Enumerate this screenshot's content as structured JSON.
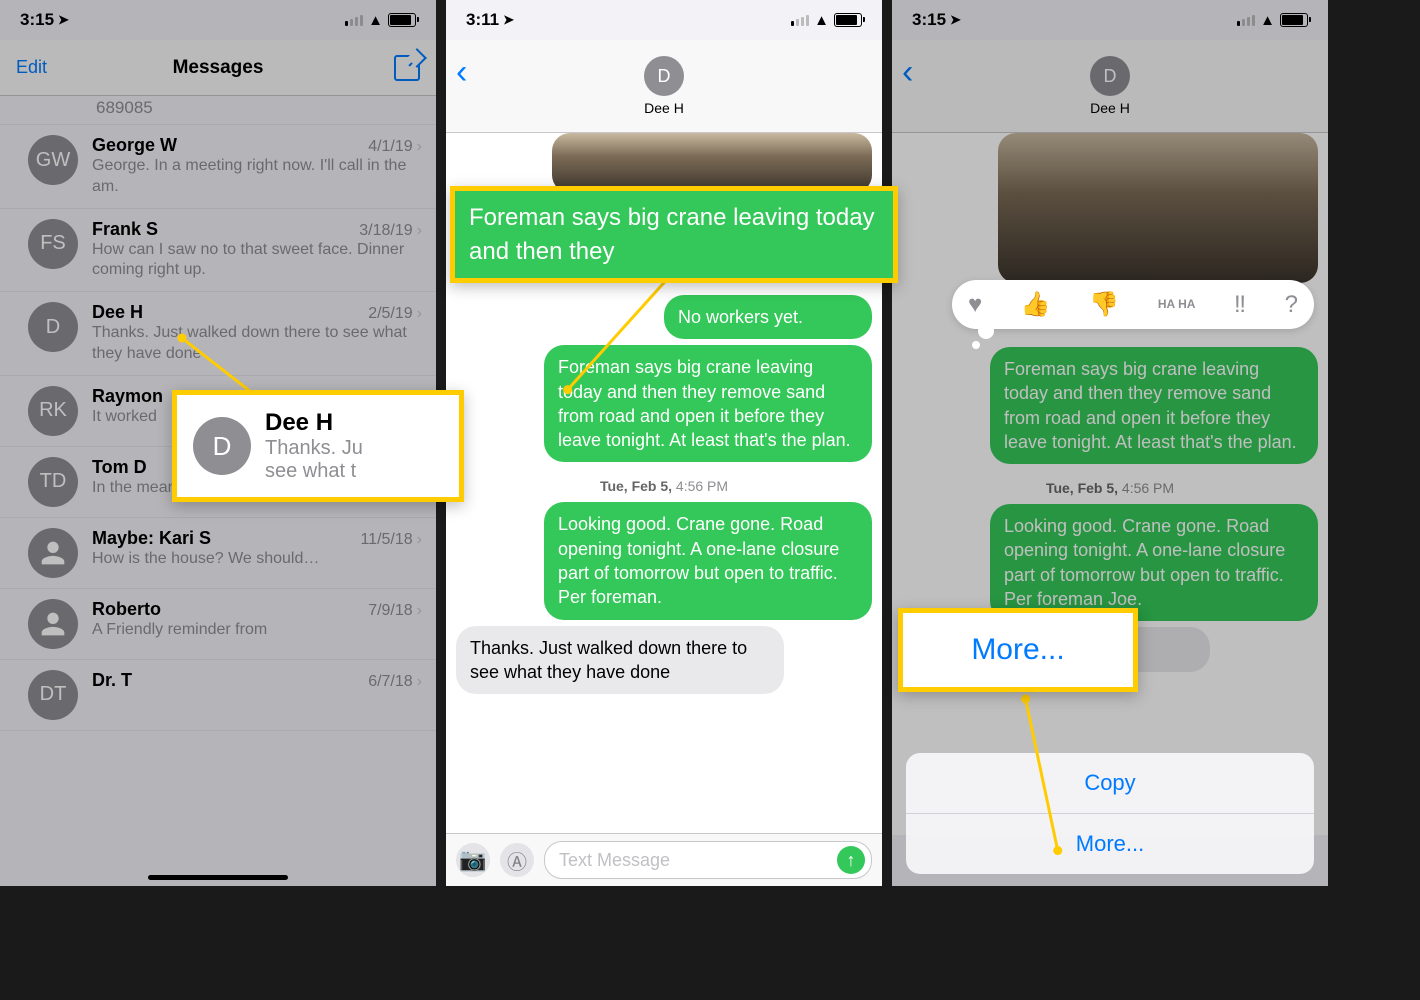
{
  "screens": {
    "s1": {
      "time": "3:15",
      "title": "Messages",
      "edit": "Edit",
      "prevrow": "689085"
    },
    "s2": {
      "time": "3:11",
      "contact": "Dee H",
      "placeholder": "Text Message"
    },
    "s3": {
      "time": "3:15",
      "contact": "Dee H"
    }
  },
  "conversations": [
    {
      "initials": "GW",
      "name": "George W",
      "date": "4/1/19",
      "preview": "George. In a meeting right now. I'll call in the am."
    },
    {
      "initials": "FS",
      "name": "Frank S",
      "date": "3/18/19",
      "preview": "How can I saw no to that sweet face. Dinner coming right up."
    },
    {
      "initials": "D",
      "name": "Dee H",
      "date": "2/5/19",
      "preview": "Thanks. Just walked down there to see what they have done"
    },
    {
      "initials": "RK",
      "name": "Raymon",
      "date": "",
      "preview": "It worked"
    },
    {
      "initials": "TD",
      "name": "Tom D",
      "date": "",
      "preview": "In the meantime my car will look v…"
    },
    {
      "initials": "",
      "name": "Maybe: Kari S",
      "date": "11/5/18",
      "preview": "How is the house?  We should…",
      "silhouette": true
    },
    {
      "initials": "",
      "name": "Roberto",
      "date": "7/9/18",
      "preview": "A Friendly reminder from",
      "silhouette": true
    },
    {
      "initials": "DT",
      "name": "Dr.  T",
      "date": "6/7/18",
      "preview": ""
    }
  ],
  "thread": {
    "m1": "No workers yet.",
    "m2": "Foreman says big crane leaving today and then they remove sand from road and open it before they leave tonight. At least that's the plan.",
    "ts_label": "Tue, Feb 5,",
    "ts_time": " 4:56 PM",
    "m3": "Looking good. Crane gone. Road opening tonight. A one-lane closure part of tomorrow but open to traffic. Per foreman.",
    "m3b": "Looking good. Crane gone. Road opening tonight. A one-lane closure part of tomorrow but open to traffic. Per foreman Joe.",
    "m4": "Thanks. Just walked down there to see what they have done",
    "m4b": "Thanks. Just walked down"
  },
  "callouts": {
    "c1_name": "Dee H",
    "c1_line1": "Thanks. Ju",
    "c1_line2": "see what t",
    "c2_text": "Foreman says big crane leaving today and then they",
    "c3_text": "More..."
  },
  "reactions": {
    "heart": "♥",
    "up": "👍",
    "down": "👎",
    "haha": "HA HA",
    "bang": "‼",
    "q": "?"
  },
  "sheet": {
    "copy": "Copy",
    "more": "More..."
  }
}
